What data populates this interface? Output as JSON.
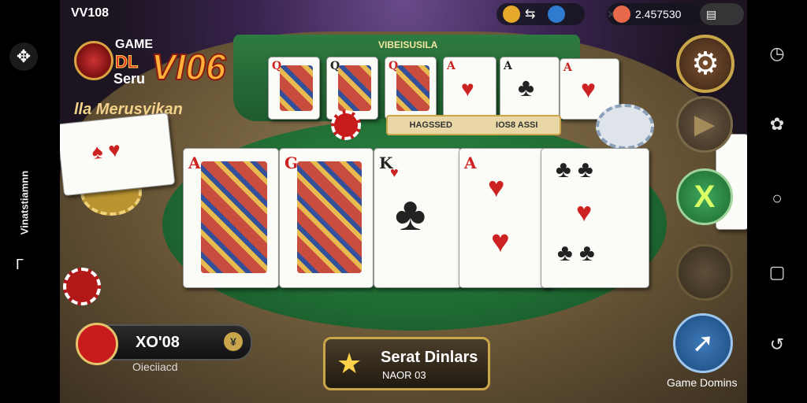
{
  "status": {
    "version": "VV108"
  },
  "hud": {
    "balance": "2.457530"
  },
  "logo": {
    "game": "GAME",
    "dl": "DL",
    "seru": "Seru",
    "big": "VI06"
  },
  "subtitle": "lla Merusyikan",
  "top_cards_title": "VIBEISUSILA",
  "info_bar": {
    "left": "HAGSSED",
    "right": "IOS8 ASSI"
  },
  "left_bar": {
    "vertical_label": "Vinatstiamnn",
    "glyph": "Γ"
  },
  "top_row_ranks": [
    "Q",
    "Q",
    "Q",
    "A",
    "A",
    "A"
  ],
  "main_row_ranks": [
    "A",
    "G",
    "K",
    "A",
    ""
  ],
  "player": {
    "score": "XO'08",
    "name": "Oieciiacd"
  },
  "action": {
    "line1": "Serat Dinlars",
    "line2": "NAOR 03"
  },
  "right_buttons": {
    "game_label": "Game Domins"
  },
  "colors": {
    "felt": "#1f6a33",
    "accent_gold": "#c9a64a",
    "logo_orange": "#ffb13a"
  }
}
